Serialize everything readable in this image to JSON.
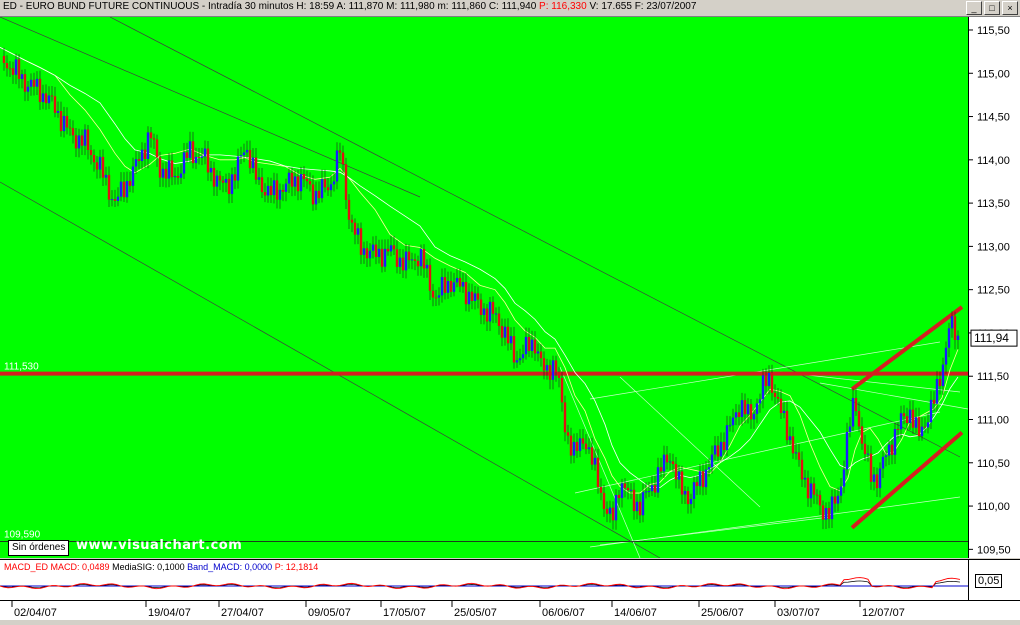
{
  "title": {
    "symbol": "ED - EURO BUND FUTURE CONTINUOUS",
    "period": "Intradía 30 minutos",
    "h": "H: 18:59",
    "a": "A: 111,870",
    "m": "M: 111,980",
    "mm": "m: 111,860",
    "c": "C: 111,940",
    "p": "P: 116,330",
    "v": "V: 17.655",
    "f": "F: 23/07/2007"
  },
  "window_buttons": [
    "_",
    "□",
    "×"
  ],
  "levels": {
    "upper_label": "111,530",
    "lower_label": "109,590"
  },
  "last_price": "111,94",
  "orders_label": "Sin órdenes",
  "watermark": "www.visualchart.com",
  "macd": {
    "name": "MACD_ED",
    "macd": "MACD: 0,0489",
    "signal": "MediaSIG: 0,1000",
    "band": "Band_MACD: 0,0000",
    "p": "P: 12,1814",
    "axis_label": "0,05"
  },
  "colors": {
    "background": "#00ff00",
    "support_line": "#d42020",
    "bull_candle": "#1a1aff",
    "bear_candle": "#e01010"
  },
  "chart_data": {
    "type": "candlestick",
    "ylim": [
      109.4,
      115.65
    ],
    "yticks": [
      "115,50",
      "115,00",
      "114,50",
      "114,00",
      "113,50",
      "113,00",
      "112,50",
      "112,00",
      "111,50",
      "111,00",
      "110,50",
      "110,00",
      "109,50"
    ],
    "x_tick_labels": [
      "02/04/07",
      "19/04/07",
      "27/04/07",
      "09/05/07",
      "17/05/07",
      "25/05/07",
      "06/06/07",
      "14/06/07",
      "25/06/07",
      "03/07/07",
      "12/07/07"
    ],
    "horizontal_lines": [
      111.53,
      109.59
    ],
    "price_path": [
      [
        0,
        115.2
      ],
      [
        25,
        114.9
      ],
      [
        40,
        114.8
      ],
      [
        55,
        114.6
      ],
      [
        70,
        114.3
      ],
      [
        85,
        114.2
      ],
      [
        100,
        113.9
      ],
      [
        115,
        113.5
      ],
      [
        125,
        113.7
      ],
      [
        135,
        113.9
      ],
      [
        150,
        114.3
      ],
      [
        160,
        113.9
      ],
      [
        175,
        113.8
      ],
      [
        190,
        114.1
      ],
      [
        205,
        114.0
      ],
      [
        220,
        113.7
      ],
      [
        235,
        113.8
      ],
      [
        245,
        114.2
      ],
      [
        255,
        113.8
      ],
      [
        270,
        113.6
      ],
      [
        285,
        113.7
      ],
      [
        300,
        113.8
      ],
      [
        315,
        113.6
      ],
      [
        330,
        113.7
      ],
      [
        340,
        114.1
      ],
      [
        350,
        113.3
      ],
      [
        360,
        113.0
      ],
      [
        375,
        112.9
      ],
      [
        390,
        112.95
      ],
      [
        405,
        112.8
      ],
      [
        420,
        112.9
      ],
      [
        435,
        112.4
      ],
      [
        450,
        112.6
      ],
      [
        465,
        112.5
      ],
      [
        480,
        112.3
      ],
      [
        495,
        112.2
      ],
      [
        505,
        112.0
      ],
      [
        515,
        111.7
      ],
      [
        525,
        111.8
      ],
      [
        535,
        111.9
      ],
      [
        545,
        111.5
      ],
      [
        555,
        111.7
      ],
      [
        565,
        110.9
      ],
      [
        575,
        110.6
      ],
      [
        585,
        110.8
      ],
      [
        595,
        110.4
      ],
      [
        605,
        110.0
      ],
      [
        612,
        109.8
      ],
      [
        620,
        110.3
      ],
      [
        630,
        110.1
      ],
      [
        640,
        110.0
      ],
      [
        650,
        110.2
      ],
      [
        660,
        110.4
      ],
      [
        670,
        110.6
      ],
      [
        680,
        110.2
      ],
      [
        690,
        110.1
      ],
      [
        700,
        110.3
      ],
      [
        710,
        110.5
      ],
      [
        720,
        110.7
      ],
      [
        730,
        110.9
      ],
      [
        740,
        111.2
      ],
      [
        750,
        111.0
      ],
      [
        760,
        111.3
      ],
      [
        770,
        111.5
      ],
      [
        780,
        111.1
      ],
      [
        790,
        110.8
      ],
      [
        800,
        110.4
      ],
      [
        810,
        110.2
      ],
      [
        820,
        110.0
      ],
      [
        830,
        109.9
      ],
      [
        840,
        110.2
      ],
      [
        848,
        110.8
      ],
      [
        855,
        111.3
      ],
      [
        862,
        110.7
      ],
      [
        870,
        110.4
      ],
      [
        878,
        110.3
      ],
      [
        886,
        110.6
      ],
      [
        894,
        110.8
      ],
      [
        902,
        111.0
      ],
      [
        910,
        111.1
      ],
      [
        918,
        110.8
      ],
      [
        926,
        111.0
      ],
      [
        934,
        111.2
      ],
      [
        942,
        111.6
      ],
      [
        950,
        112.1
      ],
      [
        958,
        111.94
      ]
    ],
    "macd_series": [
      0.0489
    ]
  }
}
